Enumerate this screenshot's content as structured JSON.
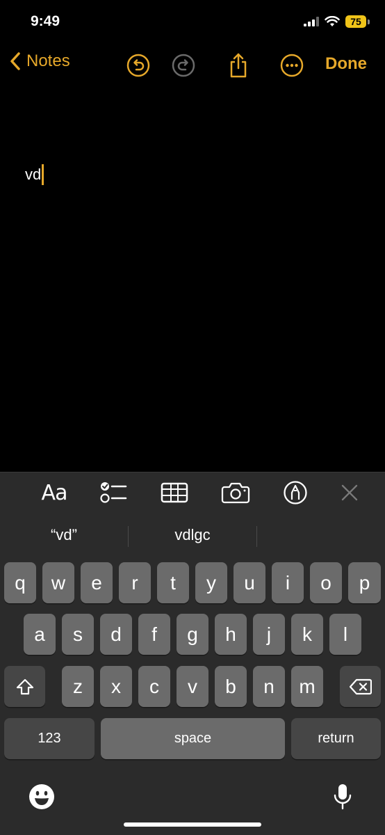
{
  "status": {
    "time": "9:49",
    "battery": "75"
  },
  "nav": {
    "back_label": "Notes",
    "done_label": "Done"
  },
  "note": {
    "text": "vd"
  },
  "toolbar": {
    "format_label": "Aa"
  },
  "suggestions": [
    "“vd”",
    "vdlgc",
    ""
  ],
  "keyboard": {
    "row1": [
      "q",
      "w",
      "e",
      "r",
      "t",
      "y",
      "u",
      "i",
      "o",
      "p"
    ],
    "row2": [
      "a",
      "s",
      "d",
      "f",
      "g",
      "h",
      "j",
      "k",
      "l"
    ],
    "row3": [
      "z",
      "x",
      "c",
      "v",
      "b",
      "n",
      "m"
    ],
    "numbers_label": "123",
    "space_label": "space",
    "return_label": "return"
  },
  "icons": {
    "back": "chevron-left-icon",
    "undo": "undo-icon",
    "redo": "redo-icon",
    "share": "share-icon",
    "more": "ellipsis-circle-icon",
    "checklist": "checklist-icon",
    "table": "table-icon",
    "camera": "camera-icon",
    "markup": "markup-pen-icon",
    "close": "close-icon",
    "shift": "shift-icon",
    "delete": "delete-icon",
    "emoji": "emoji-icon",
    "mic": "microphone-icon"
  },
  "colors": {
    "accent": "#e6a82a",
    "background": "#000000",
    "key": "#6b6b6b",
    "key_dark": "#464646",
    "keyboard_bg": "#2b2b2b"
  }
}
